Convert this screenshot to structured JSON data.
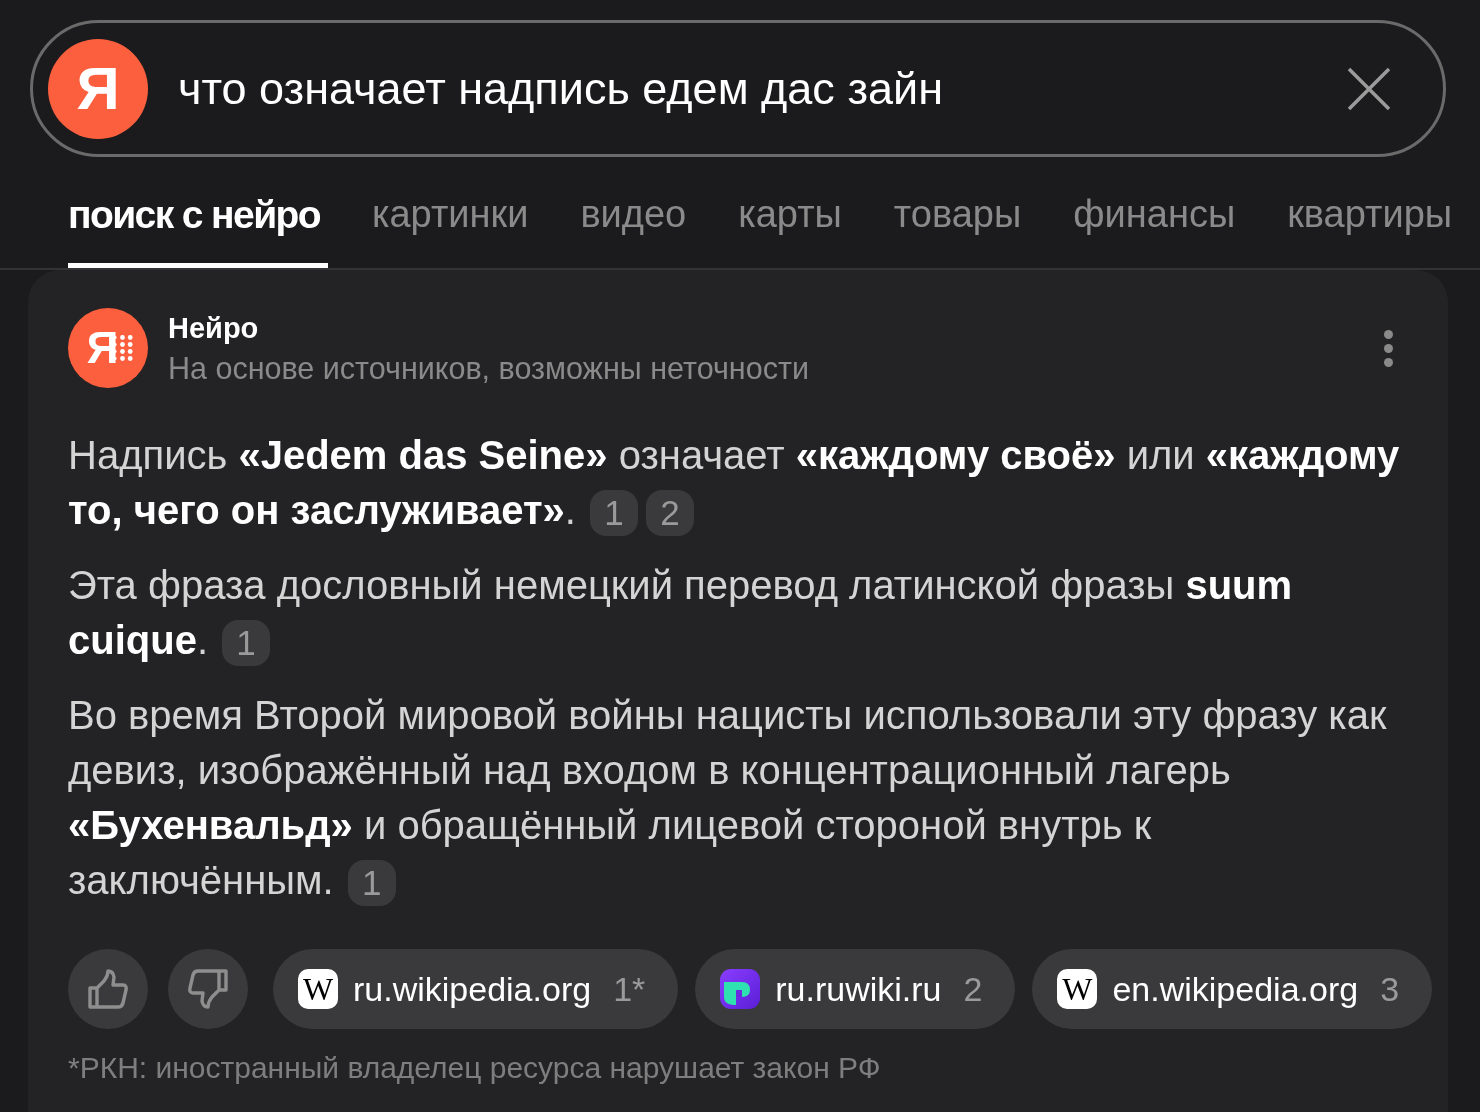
{
  "search": {
    "logo": "Я",
    "value": "что означает надпись едем дас зайн"
  },
  "tabs": [
    {
      "label": "поиск с нейро",
      "selected": true
    },
    {
      "label": "картинки",
      "selected": false
    },
    {
      "label": "видео",
      "selected": false
    },
    {
      "label": "карты",
      "selected": false
    },
    {
      "label": "товары",
      "selected": false
    },
    {
      "label": "финансы",
      "selected": false
    },
    {
      "label": "квартиры",
      "selected": false
    }
  ],
  "answer": {
    "avatar_letter": "Я",
    "title": "Нейро",
    "subtitle": "На основе источников, возможны неточности",
    "paragraphs": [
      {
        "text": "Надпись **«Jedem das Seine»** означает **«каждому своё»** или **«каждому то, чего он заслуживает»**.",
        "citations": [
          "1",
          "2"
        ]
      },
      {
        "text": "Эта фраза дословный немецкий перевод латинской фразы **suum cuique**.",
        "citations": [
          "1"
        ]
      },
      {
        "text": "Во время Второй мировой войны нацисты использовали эту фразу как девиз, изображённый над входом в концентрационный лагерь **«Бухенвальд»** и обращённый лицевой стороной внутрь к заключённым.",
        "citations": [
          "1"
        ]
      }
    ],
    "sources": [
      {
        "kind": "wikipedia",
        "favicon_letter": "W",
        "site": "ru.wikipedia.org",
        "ref": "1*"
      },
      {
        "kind": "ruwiki",
        "site": "ru.ruwiki.ru",
        "ref": "2"
      },
      {
        "kind": "wikipedia",
        "favicon_letter": "W",
        "site": "en.wikipedia.org",
        "ref": "3"
      }
    ],
    "footnote": "*РКН: иностранный владелец ресурса нарушает закон РФ"
  }
}
